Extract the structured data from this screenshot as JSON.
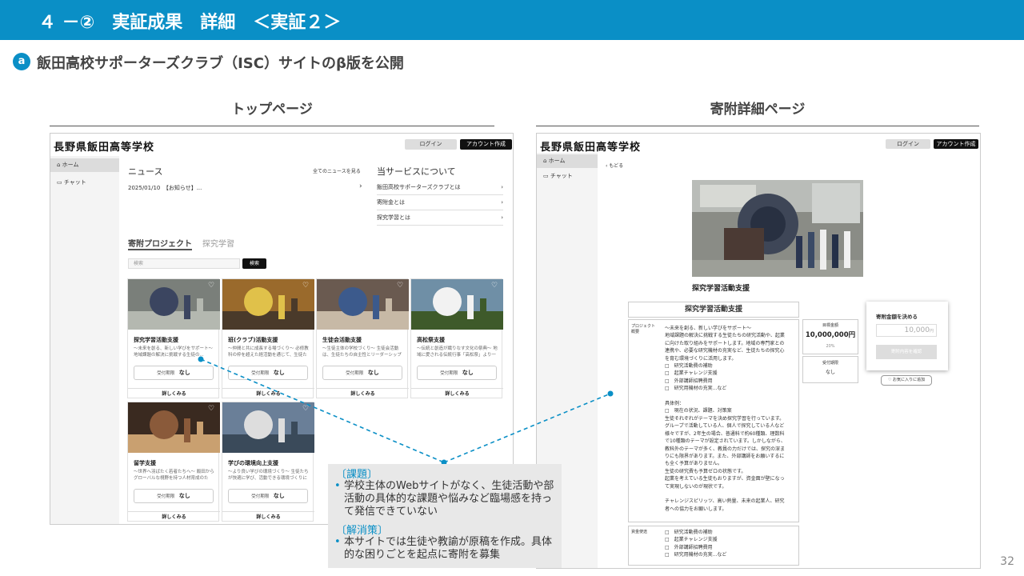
{
  "slide": {
    "title": "４ －②　実証成果　詳細　＜実証２＞",
    "badge": "a",
    "subtitle": "飯田高校サポーターズクラブ（ISC）サイトのβ版を公開",
    "left_label": "トップページ",
    "right_label": "寄附詳細ページ",
    "page_number": "32"
  },
  "site": {
    "logo": "長野県飯田高等学校",
    "login": "ログイン",
    "create_account": "アカウント作成",
    "nav": [
      {
        "label": "ホーム",
        "icon": "home-icon"
      },
      {
        "label": "チャット",
        "icon": "chat-icon"
      }
    ]
  },
  "top": {
    "news_title": "ニュース",
    "news_all": "全てのニュースを見る",
    "news_item": "2025/01/10　【お知らせ】...",
    "service_title": "当サービスについて",
    "services": [
      "飯田高校サポーターズクラブとは",
      "寄附金とは",
      "探究学習とは"
    ],
    "tab_active": "寄附プロジェクト",
    "tab_inactive": "探究学習",
    "search_placeholder": "検索",
    "search_button": "検索",
    "deadline_label": "受付期限",
    "deadline_value": "なし",
    "detail_button": "詳しくみる",
    "cards": [
      {
        "title": "探究学習活動支援",
        "desc": "〜未来を創る、新しい学びをサポート〜 地域課題の解決に挑戦する生徒の..."
      },
      {
        "title": "班(クラブ)活動支援",
        "desc": "〜仲間と共に成長する場づくり〜 必修教科の枠を超えた経活動を通じて、生徒たちはチームワークとリー..."
      },
      {
        "title": "生徒会活動支援",
        "desc": "〜生徒主体の学校づくり〜 生徒会活動は、生徒たちの自主性とリーダーシップを育む重要な場です。..."
      },
      {
        "title": "高松祭支援",
        "desc": "〜伝統と創造が織りなす文化の祭典〜 地域に愛される伝統行事「高松祭」より一層充実した文化祭となるよう..."
      },
      {
        "title": "留学支援",
        "desc": "〜世界へ羽ばたく若者たちへ〜 飯田からグローバルな視野を持つ人材育成のため、海外留学プログラムや..."
      },
      {
        "title": "学びの環境向上支援",
        "desc": "〜より良い学びの環境づくり〜 生徒たちが快適に学び、活動できる環境づくりに活用します。..."
      }
    ]
  },
  "detail": {
    "back": "‹ もどる",
    "project_title": "探究学習活動支援",
    "box_title": "探究学習活動支援",
    "overview_label": "プロジェクト概要",
    "overview_text": "〜未来を創る、新しい学びをサポート〜\n地域課題の解決に挑戦する生徒たちの研究活動や、起業\nに向けた取り組みをサポートします。地域の専門家との\n連携や、必要な研究機材の充実など、生徒たちの探究心\nを育む環境づくりに活用します。\n□　研究活動費の補助\n□　起業チャレンジ支援\n□　外部講師招聘費用\n□　研究用機材の充実...など\n\n具体例：\n□　現在の状況、課題、対策案\n生徒それぞれがテーマを決め探究学習を行っています。\nグループで活動している人、個人で探究している人など\n様々ですが、2年生の場合、普通科で約60種類、理数科\nで10種類のテーマが設定されています。しかしながら、\n教科外のテーマが多く、教員の力だけでは、探究の深ま\nりにも限界があります。また、外部講師をお願いするに\nも全く予算がありません。\n生徒の研究費も予算ゼロの状態です。\n起業を考えている生徒もおりますが、資金面が壁になっ\nて実現しないのが現状です。\n\nチャレンジスピリッツ、高い熱量、未来の起業人、研究\n者への協力をお願いします。",
    "usage_label": "資金使途",
    "usage_text": "□　研究活動費の補助\n□　起業チャレンジ支援\n□　外部講師招聘費用\n□　研究用機材の充実...など",
    "goal_label": "目標金額",
    "goal_value": "10,000,000円",
    "goal_percent": "20%",
    "deadline_label": "受付期限",
    "deadline_value": "なし",
    "decide_title": "寄附金額を決める",
    "amount_value": "10,000",
    "amount_unit": "円",
    "confirm_button": "寄附内容を確認",
    "favorite_button": "お気に入りに追加"
  },
  "popup": {
    "issue_heading": "〔課題〕",
    "issue_text": "学校主体のWebサイトがなく、生徒活動や部活動の具体的な課題や悩みなど臨場感を持って発信できていない",
    "solution_heading": "〔解消策〕",
    "solution_text": "本サイトでは生徒や教諭が原稿を作成。具体的な困りごとを起点に寄附を募集"
  }
}
